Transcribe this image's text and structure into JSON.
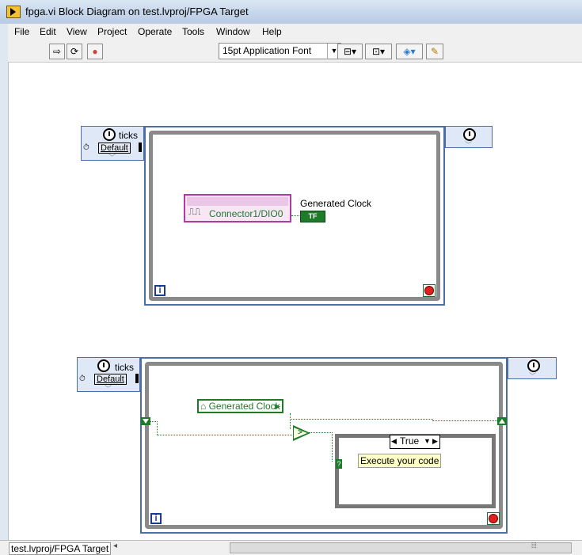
{
  "window": {
    "title": "fpga.vi Block Diagram on test.lvproj/FPGA Target"
  },
  "menu": [
    "File",
    "Edit",
    "View",
    "Project",
    "Operate",
    "Tools",
    "Window",
    "Help"
  ],
  "toolbar": {
    "font_selector": "15pt Application Font"
  },
  "loop1": {
    "timing_label": "ticks",
    "timing_default": "Default",
    "io_node_label": "Connector1/DIO0",
    "indicator_label": "Generated Clock",
    "indicator_value": "TF",
    "iteration_terminal": "i"
  },
  "loop2": {
    "timing_label": "ticks",
    "timing_default": "Default",
    "local_variable": "Generated Clock",
    "case_selector": "True",
    "comment": "Execute your code",
    "iteration_terminal": "i"
  },
  "statusbar": {
    "target": "test.lvproj/FPGA Target"
  },
  "colors": {
    "loop_border": "#4c6ea8",
    "boolean_wire": "#1f7a2a",
    "io_node": "#b03aa0"
  }
}
